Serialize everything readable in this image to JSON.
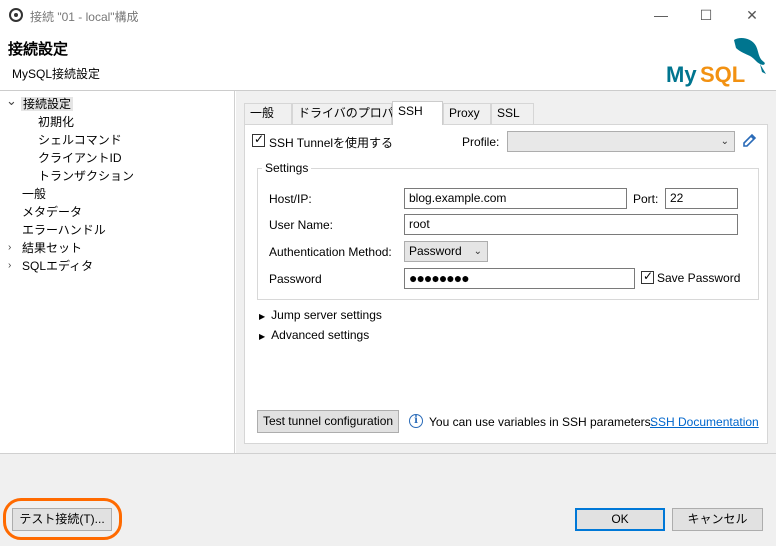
{
  "window": {
    "title": "接続 \"01 - local\"構成",
    "minimize": "—",
    "maximize": "☐",
    "close": "✕"
  },
  "header": {
    "title": "接続設定",
    "subtitle": "MySQL接続設定",
    "logo_text": "MySQL",
    "logo_color": "#00758f",
    "logo_accent": "#f29111"
  },
  "tree": {
    "items": [
      {
        "label": "接続設定",
        "expanded": true,
        "selected": true
      },
      {
        "label": "初期化"
      },
      {
        "label": "シェルコマンド"
      },
      {
        "label": "クライアントID"
      },
      {
        "label": "トランザクション"
      },
      {
        "label": "一般"
      },
      {
        "label": "メタデータ"
      },
      {
        "label": "エラーハンドル"
      },
      {
        "label": "結果セット",
        "collapsed": true
      },
      {
        "label": "SQLエディタ",
        "collapsed": true
      }
    ],
    "expand_glyph": "⌄",
    "collapse_glyph": "›"
  },
  "tabs": [
    "一般",
    "ドライバのプロパティ",
    "SSH",
    "Proxy",
    "SSL"
  ],
  "active_tab": "SSH",
  "ssh": {
    "use_tunnel_label": "SSH Tunnelを使用する",
    "use_tunnel_checked": true,
    "profile_label": "Profile:",
    "profile_value": "",
    "settings_group": "Settings",
    "host_label": "Host/IP:",
    "host_value": "blog.example.com",
    "port_label": "Port:",
    "port_value": "22",
    "user_label": "User Name:",
    "user_value": "root",
    "auth_label": "Authentication Method:",
    "auth_value": "Password",
    "password_label": "Password",
    "password_value": "●●●●●●●●",
    "save_password_label": "Save Password",
    "save_password_checked": true,
    "jump_server": "Jump server settings",
    "advanced": "Advanced settings",
    "test_button": "Test tunnel configuration",
    "info_text": "You can use variables in SSH parameters.",
    "doc_link": "SSH Documentation"
  },
  "footer": {
    "test_connection": "テスト接続(T)...",
    "ok": "OK",
    "cancel": "キャンセル",
    "highlight_color": "#ff6a00"
  }
}
